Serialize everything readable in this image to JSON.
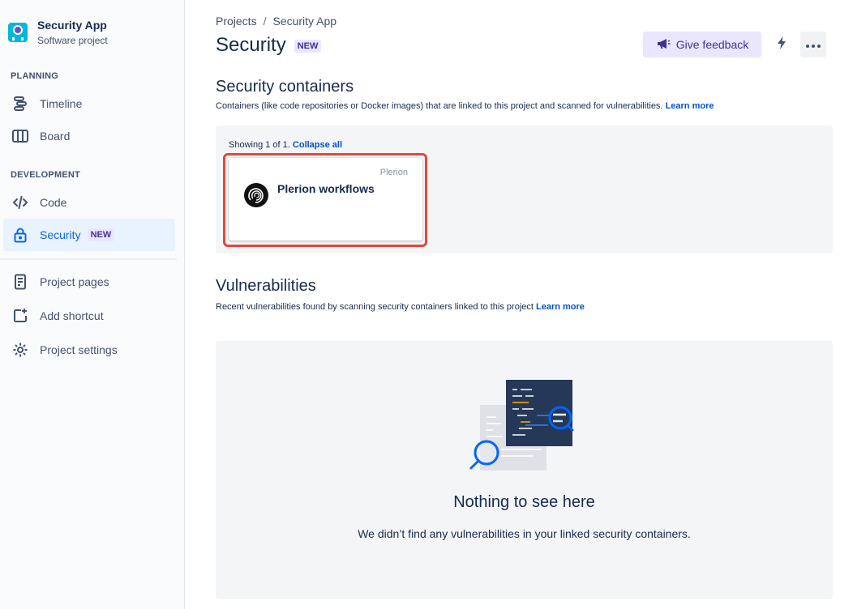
{
  "sidebar": {
    "project_name": "Security App",
    "project_type": "Software project",
    "planning_label": "PLANNING",
    "development_label": "DEVELOPMENT",
    "items": {
      "timeline": "Timeline",
      "board": "Board",
      "code": "Code",
      "security": "Security",
      "security_badge": "NEW",
      "project_pages": "Project pages",
      "add_shortcut": "Add shortcut",
      "project_settings": "Project settings"
    }
  },
  "header": {
    "breadcrumb": [
      "Projects",
      "Security App"
    ],
    "breadcrumb_separator": "/",
    "title": "Security",
    "title_badge": "NEW",
    "feedback_label": "Give feedback"
  },
  "containers": {
    "heading": "Security containers",
    "description": "Containers (like code repositories or Docker images) that are linked to this project and scanned for vulnerabilities.",
    "learn_more": "Learn more",
    "showing_text": "Showing 1 of 1.",
    "collapse_all": "Collapse all",
    "cards": [
      {
        "provider": "Plerion",
        "name": "Plerion workflows"
      }
    ]
  },
  "vulnerabilities": {
    "heading": "Vulnerabilities",
    "description": "Recent vulnerabilities found by scanning security containers linked to this project",
    "learn_more": "Learn more",
    "empty_title": "Nothing to see here",
    "empty_description": "We didn’t find any vulnerabilities in your linked security containers."
  },
  "colors": {
    "accent": "#0C66E4",
    "highlight": "#E2483D",
    "badge_bg": "#EAE6FF",
    "badge_text": "#403294"
  }
}
